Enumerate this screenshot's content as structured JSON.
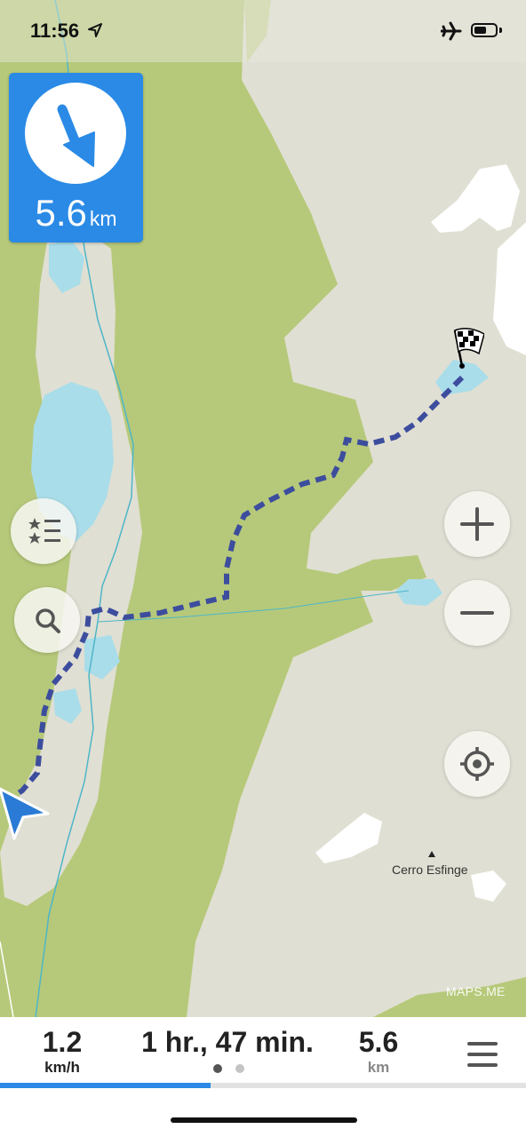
{
  "status_bar": {
    "time": "11:56",
    "location_icon": "location-arrow-icon",
    "airplane_icon": "airplane-icon",
    "battery_icon": "battery-icon"
  },
  "navigation": {
    "turn_icon": "arrow-down-right-icon",
    "distance_value": "5.6",
    "distance_unit": "km"
  },
  "map": {
    "place_label": "Cerro Esfinge",
    "copyright": "MAPS.ME",
    "colors": {
      "land": "#e0dfd3",
      "forest": "#b6c97a",
      "water": "#a9dde9",
      "glacier": "#ffffff",
      "route": "#3d4d9e",
      "route_fill": "#5c6cc0"
    }
  },
  "map_controls": {
    "bookmarks_icon": "star-list-icon",
    "search_icon": "search-icon",
    "zoom_in_icon": "plus-icon",
    "zoom_out_icon": "minus-icon",
    "location_icon": "my-location-icon"
  },
  "bottom_panel": {
    "speed_value": "1.2",
    "speed_unit": "km/h",
    "eta": "1 hr., 47 min.",
    "distance_value": "5.6",
    "distance_unit": "km",
    "menu_icon": "hamburger-menu-icon",
    "page_indicator": {
      "count": 2,
      "active": 1
    },
    "progress_fraction": 0.4
  },
  "accent_color": "#2a8ae6"
}
